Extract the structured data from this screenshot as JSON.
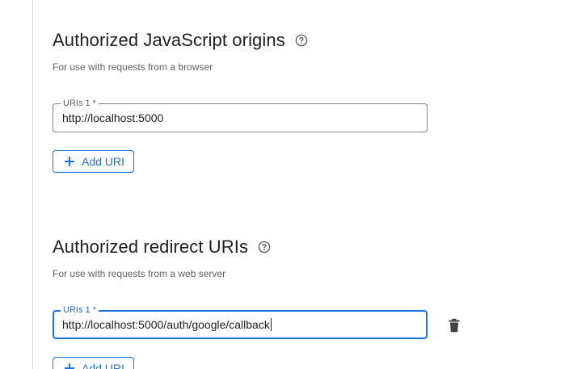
{
  "origins_section": {
    "title": "Authorized JavaScript origins",
    "subtitle": "For use with requests from a browser",
    "uri_field": {
      "label": "URIs 1 *",
      "value": "http://localhost:5000"
    },
    "add_button_label": "Add URI"
  },
  "redirect_section": {
    "title": "Authorized redirect URIs",
    "subtitle": "For use with requests from a web server",
    "uri_field": {
      "label": "URIs 1 *",
      "value": "http://localhost:5000/auth/google/callback"
    },
    "add_button_label": "Add URI"
  },
  "icons": {
    "help": "help-circle-icon",
    "plus": "plus-icon",
    "delete": "trash-icon"
  },
  "colors": {
    "accent": "#1a73e8",
    "text": "#202124",
    "secondary_text": "#5f6368",
    "border": "#80868b",
    "divider": "#dadce0"
  }
}
